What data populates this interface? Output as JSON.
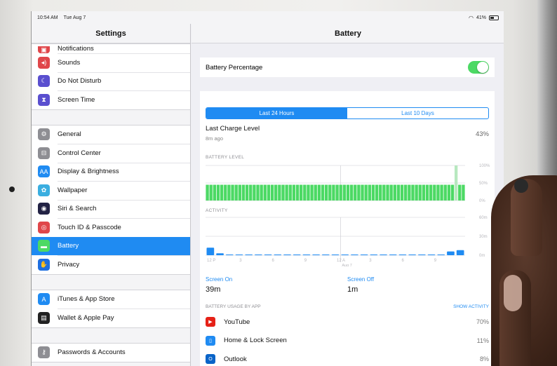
{
  "status_bar": {
    "time": "10:54 AM",
    "date": "Tue Aug 7",
    "battery": "41%"
  },
  "sidebar": {
    "title": "Settings",
    "groups": [
      [
        {
          "label": "Notifications",
          "color": "#e0464a",
          "icon": "notifications-icon"
        },
        {
          "label": "Sounds",
          "color": "#e0464a",
          "icon": "speaker-icon"
        },
        {
          "label": "Do Not Disturb",
          "color": "#5a4fcf",
          "icon": "moon-icon"
        },
        {
          "label": "Screen Time",
          "color": "#5a4fcf",
          "icon": "hourglass-icon"
        }
      ],
      [
        {
          "label": "General",
          "color": "#8e8e93",
          "icon": "gear-icon"
        },
        {
          "label": "Control Center",
          "color": "#8e8e93",
          "icon": "toggles-icon"
        },
        {
          "label": "Display & Brightness",
          "color": "#1f8bf2",
          "icon": "text-size-icon"
        },
        {
          "label": "Wallpaper",
          "color": "#3aaee0",
          "icon": "flower-icon"
        },
        {
          "label": "Siri & Search",
          "color": "#222244",
          "icon": "siri-icon"
        },
        {
          "label": "Touch ID & Passcode",
          "color": "#e0464a",
          "icon": "fingerprint-icon"
        },
        {
          "label": "Battery",
          "color": "#4cd964",
          "icon": "battery-icon",
          "selected": true
        },
        {
          "label": "Privacy",
          "color": "#1f6fe0",
          "icon": "hand-icon"
        }
      ],
      [
        {
          "label": "iTunes & App Store",
          "color": "#1f8bf2",
          "icon": "app-store-icon"
        },
        {
          "label": "Wallet & Apple Pay",
          "color": "#222222",
          "icon": "wallet-icon"
        }
      ],
      [
        {
          "label": "Passwords & Accounts",
          "color": "#8e8e93",
          "icon": "key-icon"
        }
      ]
    ]
  },
  "detail": {
    "title": "Battery",
    "battery_percentage_label": "Battery Percentage",
    "battery_percentage_on": true,
    "tabs": [
      "Last 24 Hours",
      "Last 10 Days"
    ],
    "active_tab": 0,
    "last_charge": {
      "label": "Last Charge Level",
      "sub": "8m ago",
      "value": "43%"
    },
    "battery_level_label": "BATTERY LEVEL",
    "activity_label": "ACTIVITY",
    "screen_on": {
      "label": "Screen On",
      "value": "39m"
    },
    "screen_off": {
      "label": "Screen Off",
      "value": "1m"
    },
    "usage_label": "BATTERY USAGE BY APP",
    "show_activity": "SHOW ACTIVITY",
    "apps": [
      {
        "name": "YouTube",
        "pct": "70%",
        "color": "#e62117",
        "icon": "youtube-icon"
      },
      {
        "name": "Home & Lock Screen",
        "pct": "11%",
        "color": "#1f8bf2",
        "icon": "home-screen-icon"
      },
      {
        "name": "Outlook",
        "pct": "8%",
        "color": "#0a64c8",
        "icon": "outlook-icon"
      }
    ]
  },
  "chart_data": [
    {
      "type": "bar",
      "title": "BATTERY LEVEL",
      "ylim": [
        0,
        100
      ],
      "y_ticks": [
        "100%",
        "50%",
        "0%"
      ],
      "bar_count": 72,
      "values_pct": 45,
      "charging_bar_value_pct": 100
    },
    {
      "type": "bar",
      "title": "ACTIVITY",
      "y_ticks": [
        "60m",
        "30m",
        "0m"
      ],
      "x_ticks": [
        "12 P",
        "3",
        "6",
        "9",
        "12 A",
        "3",
        "6",
        "9"
      ],
      "x_sublabel": "Aug 7",
      "values_minutes": [
        12,
        3,
        0.5,
        0.5,
        0.5,
        0.5,
        0.5,
        0.5,
        0.5,
        0.5,
        0.5,
        0.5,
        0.5,
        0.5,
        0.5,
        0.5,
        0.5,
        0.5,
        0.5,
        0.5,
        0.5,
        0.5,
        0.5,
        0.5,
        0.5,
        6,
        8
      ]
    }
  ]
}
